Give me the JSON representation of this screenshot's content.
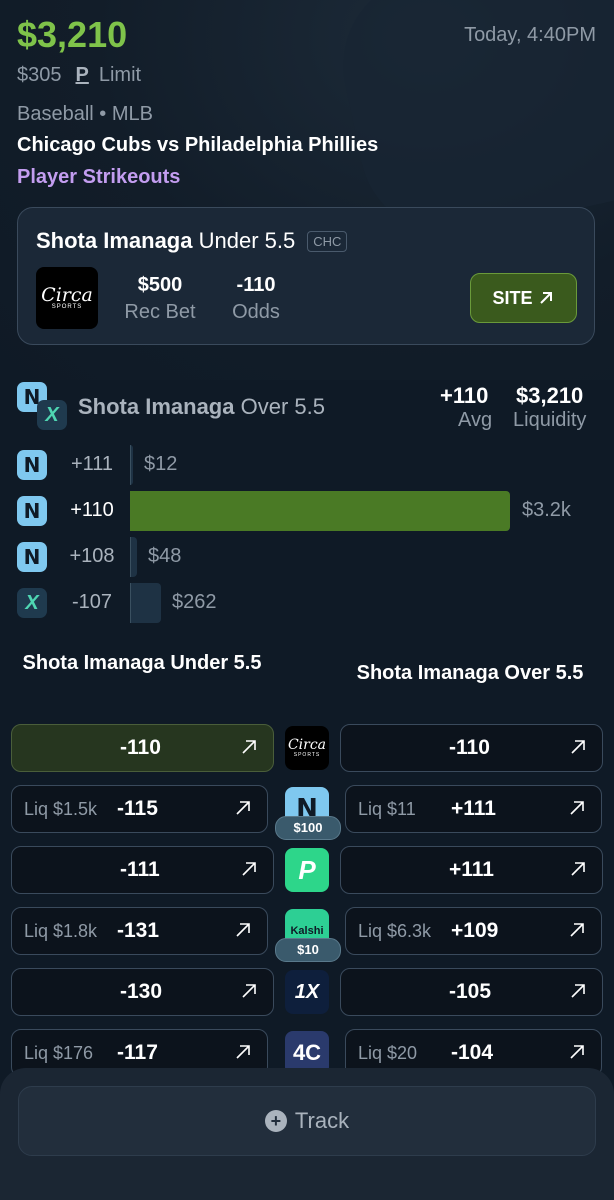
{
  "header": {
    "amount": "$3,210",
    "time": "Today, 4:40PM",
    "limit_amount": "$305",
    "limit_p": "P",
    "limit_label": "Limit",
    "sport": "Baseball",
    "league": "MLB",
    "separator": "•",
    "matchup": "Chicago Cubs vs Philadelphia Phillies",
    "market": "Player Strikeouts"
  },
  "card": {
    "player": "Shota Imanaga",
    "line": "Under 5.5",
    "team_tag": "CHC",
    "book_logo_text": "Circa",
    "book_logo_sub": "SPORTS",
    "rec_bet_value": "$500",
    "rec_bet_label": "Rec Bet",
    "odds_value": "-110",
    "odds_label": "Odds",
    "site_label": "SITE"
  },
  "liquidity": {
    "player": "Shota Imanaga",
    "line": "Over 5.5",
    "avg_value": "+110",
    "avg_label": "Avg",
    "liquidity_value": "$3,210",
    "liquidity_label": "Liquidity",
    "rows": [
      {
        "icon": "novig-icon",
        "odds": "+111",
        "amount": "$12",
        "share": 0.004,
        "highlight": false
      },
      {
        "icon": "novig-icon",
        "odds": "+110",
        "amount": "$3.2k",
        "share": 1.0,
        "highlight": true
      },
      {
        "icon": "novig-icon",
        "odds": "+108",
        "amount": "$48",
        "share": 0.015,
        "highlight": false
      },
      {
        "icon": "prophetx-icon",
        "odds": "-107",
        "amount": "$262",
        "share": 0.08,
        "highlight": false
      }
    ]
  },
  "columns": {
    "left_header": "Shota Imanaga Under 5.5",
    "right_header": "Shota Imanaga Over 5.5"
  },
  "books": [
    {
      "icon": "circa-sports-icon",
      "left_liq": "",
      "left_odds": "-110",
      "left_highlight": true,
      "right_liq": "",
      "right_odds": "-110",
      "badge": ""
    },
    {
      "icon": "novig-icon",
      "left_liq": "Liq $1.5k",
      "left_odds": "-115",
      "left_highlight": false,
      "right_liq": "Liq $11",
      "right_odds": "+111",
      "badge": "$100"
    },
    {
      "icon": "prizepicks-icon",
      "left_liq": "",
      "left_odds": "-111",
      "left_highlight": false,
      "right_liq": "",
      "right_odds": "+111",
      "badge": ""
    },
    {
      "icon": "kalshi-icon",
      "left_liq": "Liq $1.8k",
      "left_odds": "-131",
      "left_highlight": false,
      "right_liq": "Liq $6.3k",
      "right_odds": "+109",
      "badge": "$10"
    },
    {
      "icon": "1xbet-icon",
      "left_liq": "",
      "left_odds": "-130",
      "left_highlight": false,
      "right_liq": "",
      "right_odds": "-105",
      "badge": ""
    },
    {
      "icon": "4cx-icon",
      "left_liq": "Liq $176",
      "left_odds": "-117",
      "left_highlight": false,
      "right_liq": "Liq $20",
      "right_odds": "-104",
      "badge": ""
    }
  ],
  "book_labels": {
    "circa_main": "Circa",
    "circa_sub": "SPORTS",
    "kalshi": "Kalshi",
    "onex": "1X",
    "fourc": "4C"
  },
  "track": {
    "label": "Track",
    "plus": "+"
  },
  "colors": {
    "accent_green": "#7fc34a",
    "purple": "#c39df0",
    "bar_green": "#4a7a25"
  }
}
